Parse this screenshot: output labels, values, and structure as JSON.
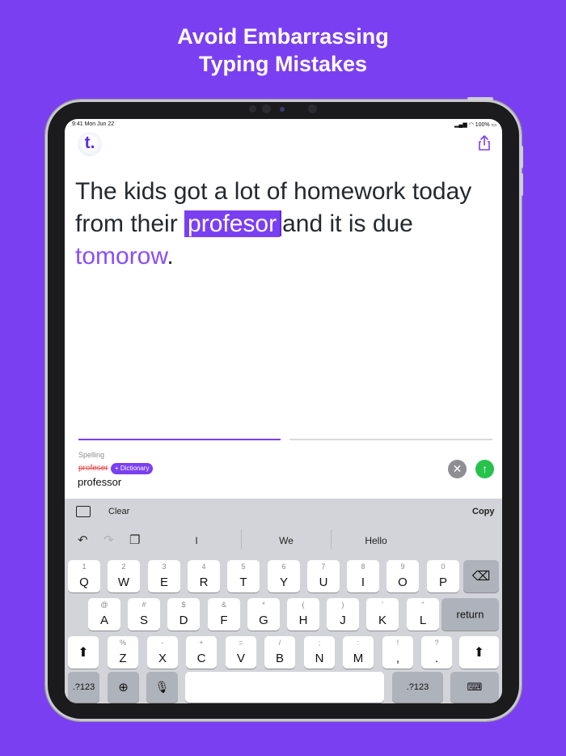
{
  "headline": {
    "line1": "Avoid Embarrassing",
    "line2": "Typing Mistakes"
  },
  "status_bar": {
    "time_date": "9:41  Mon Jun 22",
    "battery": "100%"
  },
  "app": {
    "logo_letter": "t.",
    "icons": [
      "share-icon"
    ]
  },
  "editor": {
    "text_before": "The kids got a lot of homework today from their ",
    "highlighted_word": "profesor",
    "text_middle": "and it is due ",
    "accent_word": "tomorow",
    "text_end": ".",
    "accent_color": "#7b3ff2"
  },
  "suggestion": {
    "category": "Spelling",
    "misspelled": "profeser",
    "dictionary_label": "+ Dictionary",
    "correction": "professor"
  },
  "toolbar": {
    "clear_label": "Clear",
    "copy_label": "Copy"
  },
  "predictions": [
    "I",
    "We",
    "Hello"
  ],
  "keyboard": {
    "row1": [
      {
        "sub": "1",
        "main": "Q"
      },
      {
        "sub": "2",
        "main": "W"
      },
      {
        "sub": "3",
        "main": "E"
      },
      {
        "sub": "4",
        "main": "R"
      },
      {
        "sub": "5",
        "main": "T"
      },
      {
        "sub": "6",
        "main": "Y"
      },
      {
        "sub": "7",
        "main": "U"
      },
      {
        "sub": "8",
        "main": "I"
      },
      {
        "sub": "9",
        "main": "O"
      },
      {
        "sub": "0",
        "main": "P"
      }
    ],
    "row2": [
      {
        "sub": "@",
        "main": "A"
      },
      {
        "sub": "#",
        "main": "S"
      },
      {
        "sub": "$",
        "main": "D"
      },
      {
        "sub": "&",
        "main": "F"
      },
      {
        "sub": "*",
        "main": "G"
      },
      {
        "sub": "(",
        "main": "H"
      },
      {
        "sub": ")",
        "main": "J"
      },
      {
        "sub": "'",
        "main": "K"
      },
      {
        "sub": "\"",
        "main": "L"
      }
    ],
    "row3": [
      {
        "sub": "%",
        "main": "Z"
      },
      {
        "sub": "-",
        "main": "X"
      },
      {
        "sub": "+",
        "main": "C"
      },
      {
        "sub": "=",
        "main": "V"
      },
      {
        "sub": "/",
        "main": "B"
      },
      {
        "sub": ";",
        "main": "N"
      },
      {
        "sub": ":",
        "main": "M"
      },
      {
        "sub": "!",
        "main": ","
      },
      {
        "sub": "?",
        "main": "."
      }
    ],
    "return_label": "return",
    "numbers_label": ".?123"
  }
}
